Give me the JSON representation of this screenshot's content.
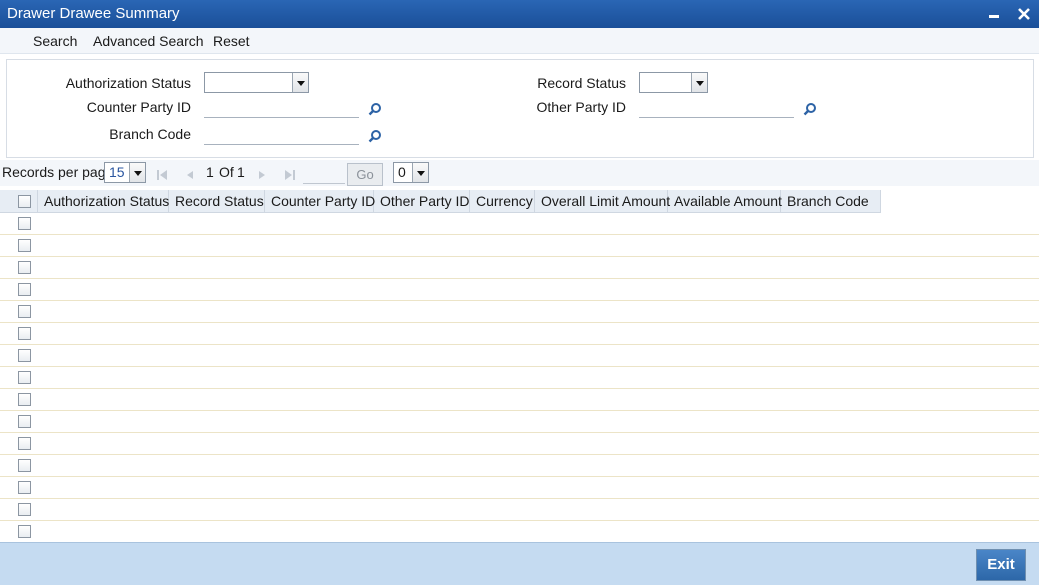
{
  "window": {
    "title": "Drawer Drawee Summary"
  },
  "toolbar": {
    "search": "Search",
    "advanced_search": "Advanced Search",
    "reset": "Reset"
  },
  "form": {
    "authorization_status": {
      "label": "Authorization Status",
      "value": ""
    },
    "record_status": {
      "label": "Record Status",
      "value": ""
    },
    "counter_party_id": {
      "label": "Counter Party ID",
      "value": ""
    },
    "other_party_id": {
      "label": "Other Party ID",
      "value": ""
    },
    "branch_code": {
      "label": "Branch Code",
      "value": ""
    }
  },
  "pager": {
    "records_per_page_label": "Records per page",
    "records_per_page": "15",
    "current_page": "1",
    "of_label": "Of",
    "total_pages": "1",
    "go_label": "Go",
    "page_select": "0"
  },
  "grid": {
    "columns": [
      "Authorization Status",
      "Record Status",
      "Counter Party ID",
      "Other Party ID",
      "Currency",
      "Overall Limit Amount",
      "Available Amount",
      "Branch Code"
    ],
    "row_count": 15
  },
  "footer": {
    "exit_label": "Exit"
  },
  "colors": {
    "titlebar": "#1f5aa6",
    "footer": "#c5dbf1",
    "exit_button": "#3a75b8"
  }
}
